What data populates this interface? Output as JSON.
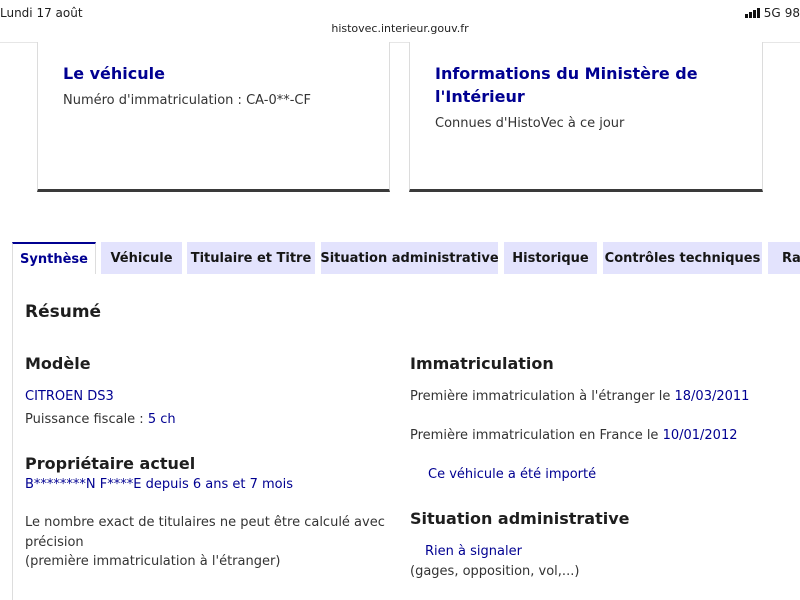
{
  "status": {
    "date": "Lundi 17 août",
    "network": "5G",
    "battery": "98"
  },
  "browser": {
    "url": "histovec.interieur.gouv.fr"
  },
  "cards": {
    "vehicle": {
      "title": "Le véhicule",
      "plate_label": "Numéro d'immatriculation : ",
      "plate": "CA-0**-CF"
    },
    "ministry": {
      "title": "Informations du Ministère de l'Intérieur",
      "subtitle": "Connues d'HistoVec à ce jour"
    }
  },
  "tabs": [
    {
      "label": "Synthèse",
      "active": true
    },
    {
      "label": "Véhicule"
    },
    {
      "label": "Titulaire et Titre"
    },
    {
      "label": "Situation administrative"
    },
    {
      "label": "Historique"
    },
    {
      "label": "Contrôles techniques"
    },
    {
      "label": "Rap"
    }
  ],
  "summary": {
    "title": "Résumé",
    "model": {
      "heading": "Modèle",
      "name": "CITROEN DS3",
      "power_label": "Puissance fiscale : ",
      "power": "5 ch"
    },
    "owner": {
      "heading": "Propriétaire actuel",
      "name": "B********N F****E",
      "since_label": " depuis ",
      "since": "6 ans et 7 mois",
      "note_line1": "Le nombre exact de titulaires ne peut être calculé avec",
      "note_line2": "précision",
      "note_line3": "(première immatriculation à l'étranger)"
    },
    "registration": {
      "heading": "Immatriculation",
      "foreign_label": "Première immatriculation à l'étranger le ",
      "foreign_date": "18/03/2011",
      "france_label": "Première immatriculation en France le ",
      "france_date": "10/01/2012",
      "imported": "Ce véhicule a été importé"
    },
    "admin": {
      "heading": "Situation administrative",
      "status": "Rien à signaler",
      "detail": "(gages, opposition, vol,...)"
    }
  }
}
